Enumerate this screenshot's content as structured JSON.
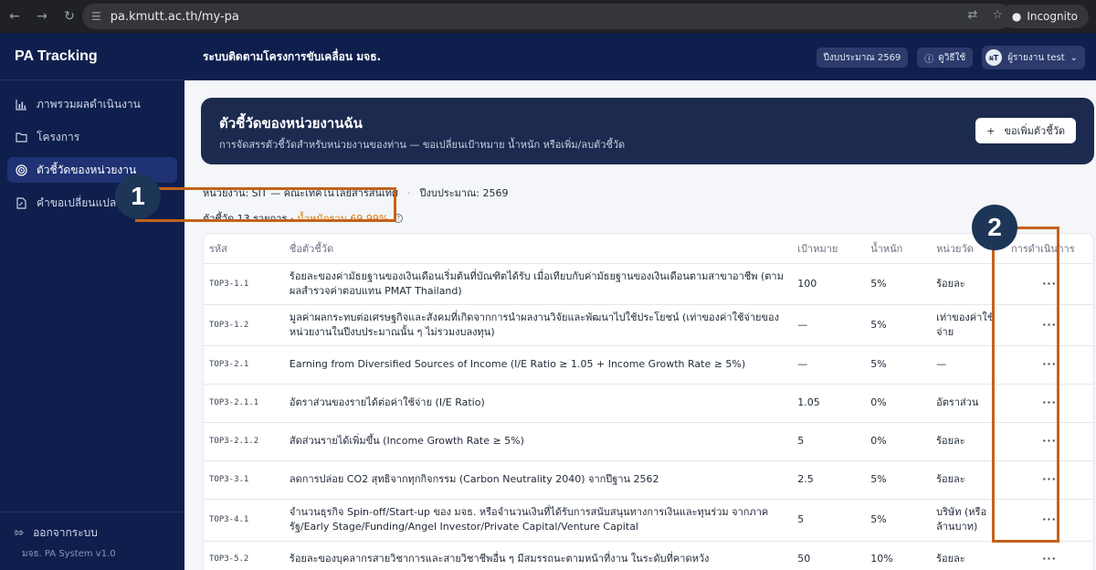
{
  "browser": {
    "url": "pa.kmutt.ac.th/my-pa",
    "incognito_label": "Incognito"
  },
  "sidebar": {
    "brand": "PA Tracking",
    "items": [
      {
        "label": "ภาพรวมผลดำเนินงาน",
        "icon": "bar-chart-icon"
      },
      {
        "label": "โครงการ",
        "icon": "folder-icon"
      },
      {
        "label": "ตัวชี้วัดของหน่วยงาน",
        "icon": "target-icon",
        "active": true
      },
      {
        "label": "คำขอเปลี่ยนแปลง PA",
        "icon": "document-edit-icon"
      }
    ],
    "logout_label": "ออกจากระบบ",
    "version": "มจธ. PA System v1.0"
  },
  "header": {
    "title": "ระบบติดตามโครงการขับเคลื่อน มจธ.",
    "fiscal_year": "ปีงบประมาณ 2569",
    "help_label": "ดูวิธีใช้",
    "avatar_initials": "ผT",
    "user_name": "ผู้รายงาน test"
  },
  "banner": {
    "title": "ตัวชี้วัดของหน่วยงานฉัน",
    "subtitle": "การจัดสรรตัวชี้วัดสำหรับหน่วยงานของท่าน — ขอเปลี่ยนเป้าหมาย น้ำหนัก หรือเพิ่ม/ลบตัวชี้วัด",
    "add_button": "ขอเพิ่มตัวชี้วัด"
  },
  "meta": {
    "unit": "หน่วยงาน: SIT — คณะเทคโนโลยีสารสนเทศ",
    "fiscal": "ปีงบประมาณ: 2569",
    "count": "ตัวชี้วัด 13 รายการ ·",
    "weight": "น้ำหนักรวม 69.99%"
  },
  "table": {
    "headers": [
      "รหัส",
      "ชื่อตัวชี้วัด",
      "เป้าหมาย",
      "น้ำหนัก",
      "หน่วยวัด",
      "การดำเนินการ"
    ],
    "rows": [
      {
        "code": "TOP3-1.1",
        "name": "ร้อยละของค่ามัธยฐานของเงินเดือนเริ่มต้นที่บัณฑิตได้รับ เมื่อเทียบกับค่ามัธยฐานของเงินเดือนตามสาขาอาชีพ (ตามผลสำรวจค่าตอบแทน PMAT Thailand)",
        "target": "100",
        "weight": "5%",
        "unit": "ร้อยละ",
        "action": "···"
      },
      {
        "code": "TOP3-1.2",
        "name": "มูลค่าผลกระทบต่อเศรษฐกิจและสังคมที่เกิดจากการนำผลงานวิจัยและพัฒนาไปใช้ประโยชน์ (เท่าของค่าใช้จ่ายของหน่วยงานในปีงบประมาณนั้น ๆ ไม่รวมงบลงทุน)",
        "target": "—",
        "weight": "5%",
        "unit": "เท่าของค่าใช้จ่าย",
        "action": "···"
      },
      {
        "code": "TOP3-2.1",
        "name": "Earning from Diversified Sources of Income (I/E Ratio ≥ 1.05 + Income Growth Rate ≥ 5%)",
        "target": "—",
        "weight": "5%",
        "unit": "—",
        "action": "···"
      },
      {
        "code": "TOP3-2.1.1",
        "name": "อัตราส่วนของรายได้ต่อค่าใช้จ่าย (I/E Ratio)",
        "target": "1.05",
        "weight": "0%",
        "unit": "อัตราส่วน",
        "action": "···"
      },
      {
        "code": "TOP3-2.1.2",
        "name": "สัดส่วนรายได้เพิ่มขึ้น (Income Growth Rate ≥ 5%)",
        "target": "5",
        "weight": "0%",
        "unit": "ร้อยละ",
        "action": "···"
      },
      {
        "code": "TOP3-3.1",
        "name": "ลดการปล่อย CO2 สุทธิจากทุกกิจกรรม (Carbon Neutrality 2040) จากปีฐาน 2562",
        "target": "2.5",
        "weight": "5%",
        "unit": "ร้อยละ",
        "action": "···"
      },
      {
        "code": "TOP3-4.1",
        "name": "จำนวนธุรกิจ Spin-off/Start-up ของ มจธ. หรือจำนวนเงินที่ได้รับการสนับสนุนทางการเงินและทุนร่วม จากภาครัฐ/Early Stage/Funding/Angel Investor/Private Capital/Venture Capital",
        "target": "5",
        "weight": "5%",
        "unit": "บริษัท (หรือล้านบาท)",
        "action": "···"
      },
      {
        "code": "TOP3-5.2",
        "name": "ร้อยละของบุคลากรสายวิชาการและสายวิชาชีพอื่น ๆ มีสมรรถนะตามหน้าที่งาน ในระดับที่คาดหวัง",
        "target": "50",
        "weight": "10%",
        "unit": "ร้อยละ",
        "action": "···"
      }
    ]
  },
  "annotations": [
    "1",
    "2"
  ]
}
